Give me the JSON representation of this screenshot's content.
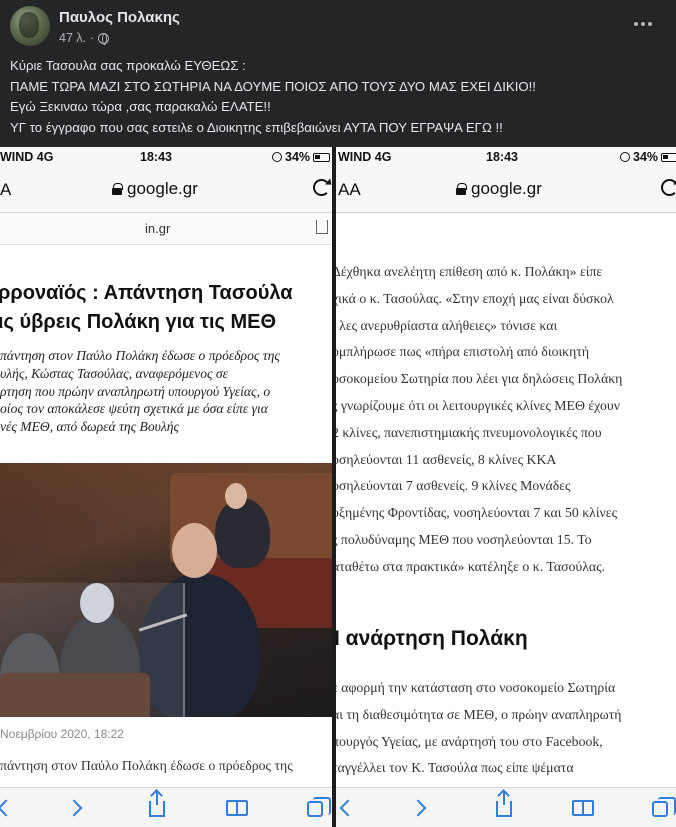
{
  "post": {
    "author": "Παυλος Πολακης",
    "time": "47 λ.",
    "lines": [
      "Κύριε  Τασουλα σας προκαλώ ΕΥΘΕΩΣ :",
      "ΠΑΜΕ ΤΩΡΑ ΜΑΖΙ ΣΤΟ ΣΩΤΗΡΙΑ ΝΑ ΔΟΥΜΕ ΠΟΙΟΣ ΑΠΟ ΤΟΥΣ ΔΥΟ ΜΑΣ ΕΧΕΙ ΔΙΚΙΟ!!",
      "Εγώ Ξεκιναω τώρα ,σας παρακαλώ ΕΛΑΤΕ!!",
      "ΥΓ το έγγραφο που σας εστειλε ο Διοικητης επιβεβαιώνει ΑΥΤΑ ΠΟΥ ΕΓΡΑΨΑ ΕΓΩ !!"
    ]
  },
  "left_screenshot": {
    "carrier": "WIND  4G",
    "time": "18:43",
    "battery": "34%",
    "aa": "A",
    "domain": "google.gr",
    "site": "in.gr",
    "headline": [
      "ρροναϊός : Απάντηση Τασούλα",
      "ις ύβρεις Πολάκη για τις ΜΕΘ"
    ],
    "lede": [
      "πάντηση στον Παύλο Πολάκη έδωσε ο πρόεδρος της",
      "υλής, Κώστας Τασούλας, αναφερόμενος σε",
      "ρτηση που πρώην αναπληρωτή υπουργού Υγείας, ο",
      "οίος τον αποκάλεσε ψεύτη σχετικά με όσα είπε για",
      "νές ΜΕΘ, από δωρεά της Βουλής"
    ],
    "caption": "Νοεμβρίου 2020, 18:22",
    "body": [
      "πάντηση στον Παύλο Πολάκη έδωσε ο πρόεδρος της"
    ]
  },
  "right_screenshot": {
    "carrier": "WIND  4G",
    "time": "18:43",
    "battery": "34%",
    "aa": "AA",
    "domain": "google.gr",
    "body": [
      "Δέχθηκα ανελέητη επίθεση από κ. Πολάκη» είπε",
      "χικά ο κ. Τασούλας. «Στην εποχή μας είναι δύσκολ",
      "ι λες ανερυθρίαστα αλήθειες» τόνισε και",
      "υμπλήρωσε πως «πήρα επιστολή από διοικητή",
      "οσοκομείου Σωτηρία που λέει για δηλώσεις Πολάκη",
      "ς γνωρίζουμε ότι οι λειτουργικές κλίνες ΜΕΘ έχουν",
      "2 κλίνες, πανεπιστημιακής πνευμονολογικές που",
      "οσηλεύονται 11 ασθενείς, 8 κλίνες ΚΚΑ",
      "οσηλεύονται 7 ασθενείς. 9 κλίνες Μονάδες",
      "υξημένης Φροντίδας, νοσηλεύονται 7 και 50 κλίνες",
      "ς πολυδύναμης ΜΕΘ που νοσηλεύονται 15. Το",
      "αταθέτω στα πρακτικά» κατέληξε ο κ. Τασούλας."
    ],
    "section_head": "Ι ανάρτηση Πολάκη",
    "body2": [
      "ε αφορμή την κατάσταση στο νοσοκομείο Σωτηρία",
      "αι τη διαθεσιμότητα σε ΜΕΘ, ο πρώην αναπληρωτή",
      "πουργός Υγείας, με ανάρτησή του στο Facebook,",
      "ταγγέλλει τον Κ. Τασούλα πως είπε ψέματα"
    ]
  }
}
